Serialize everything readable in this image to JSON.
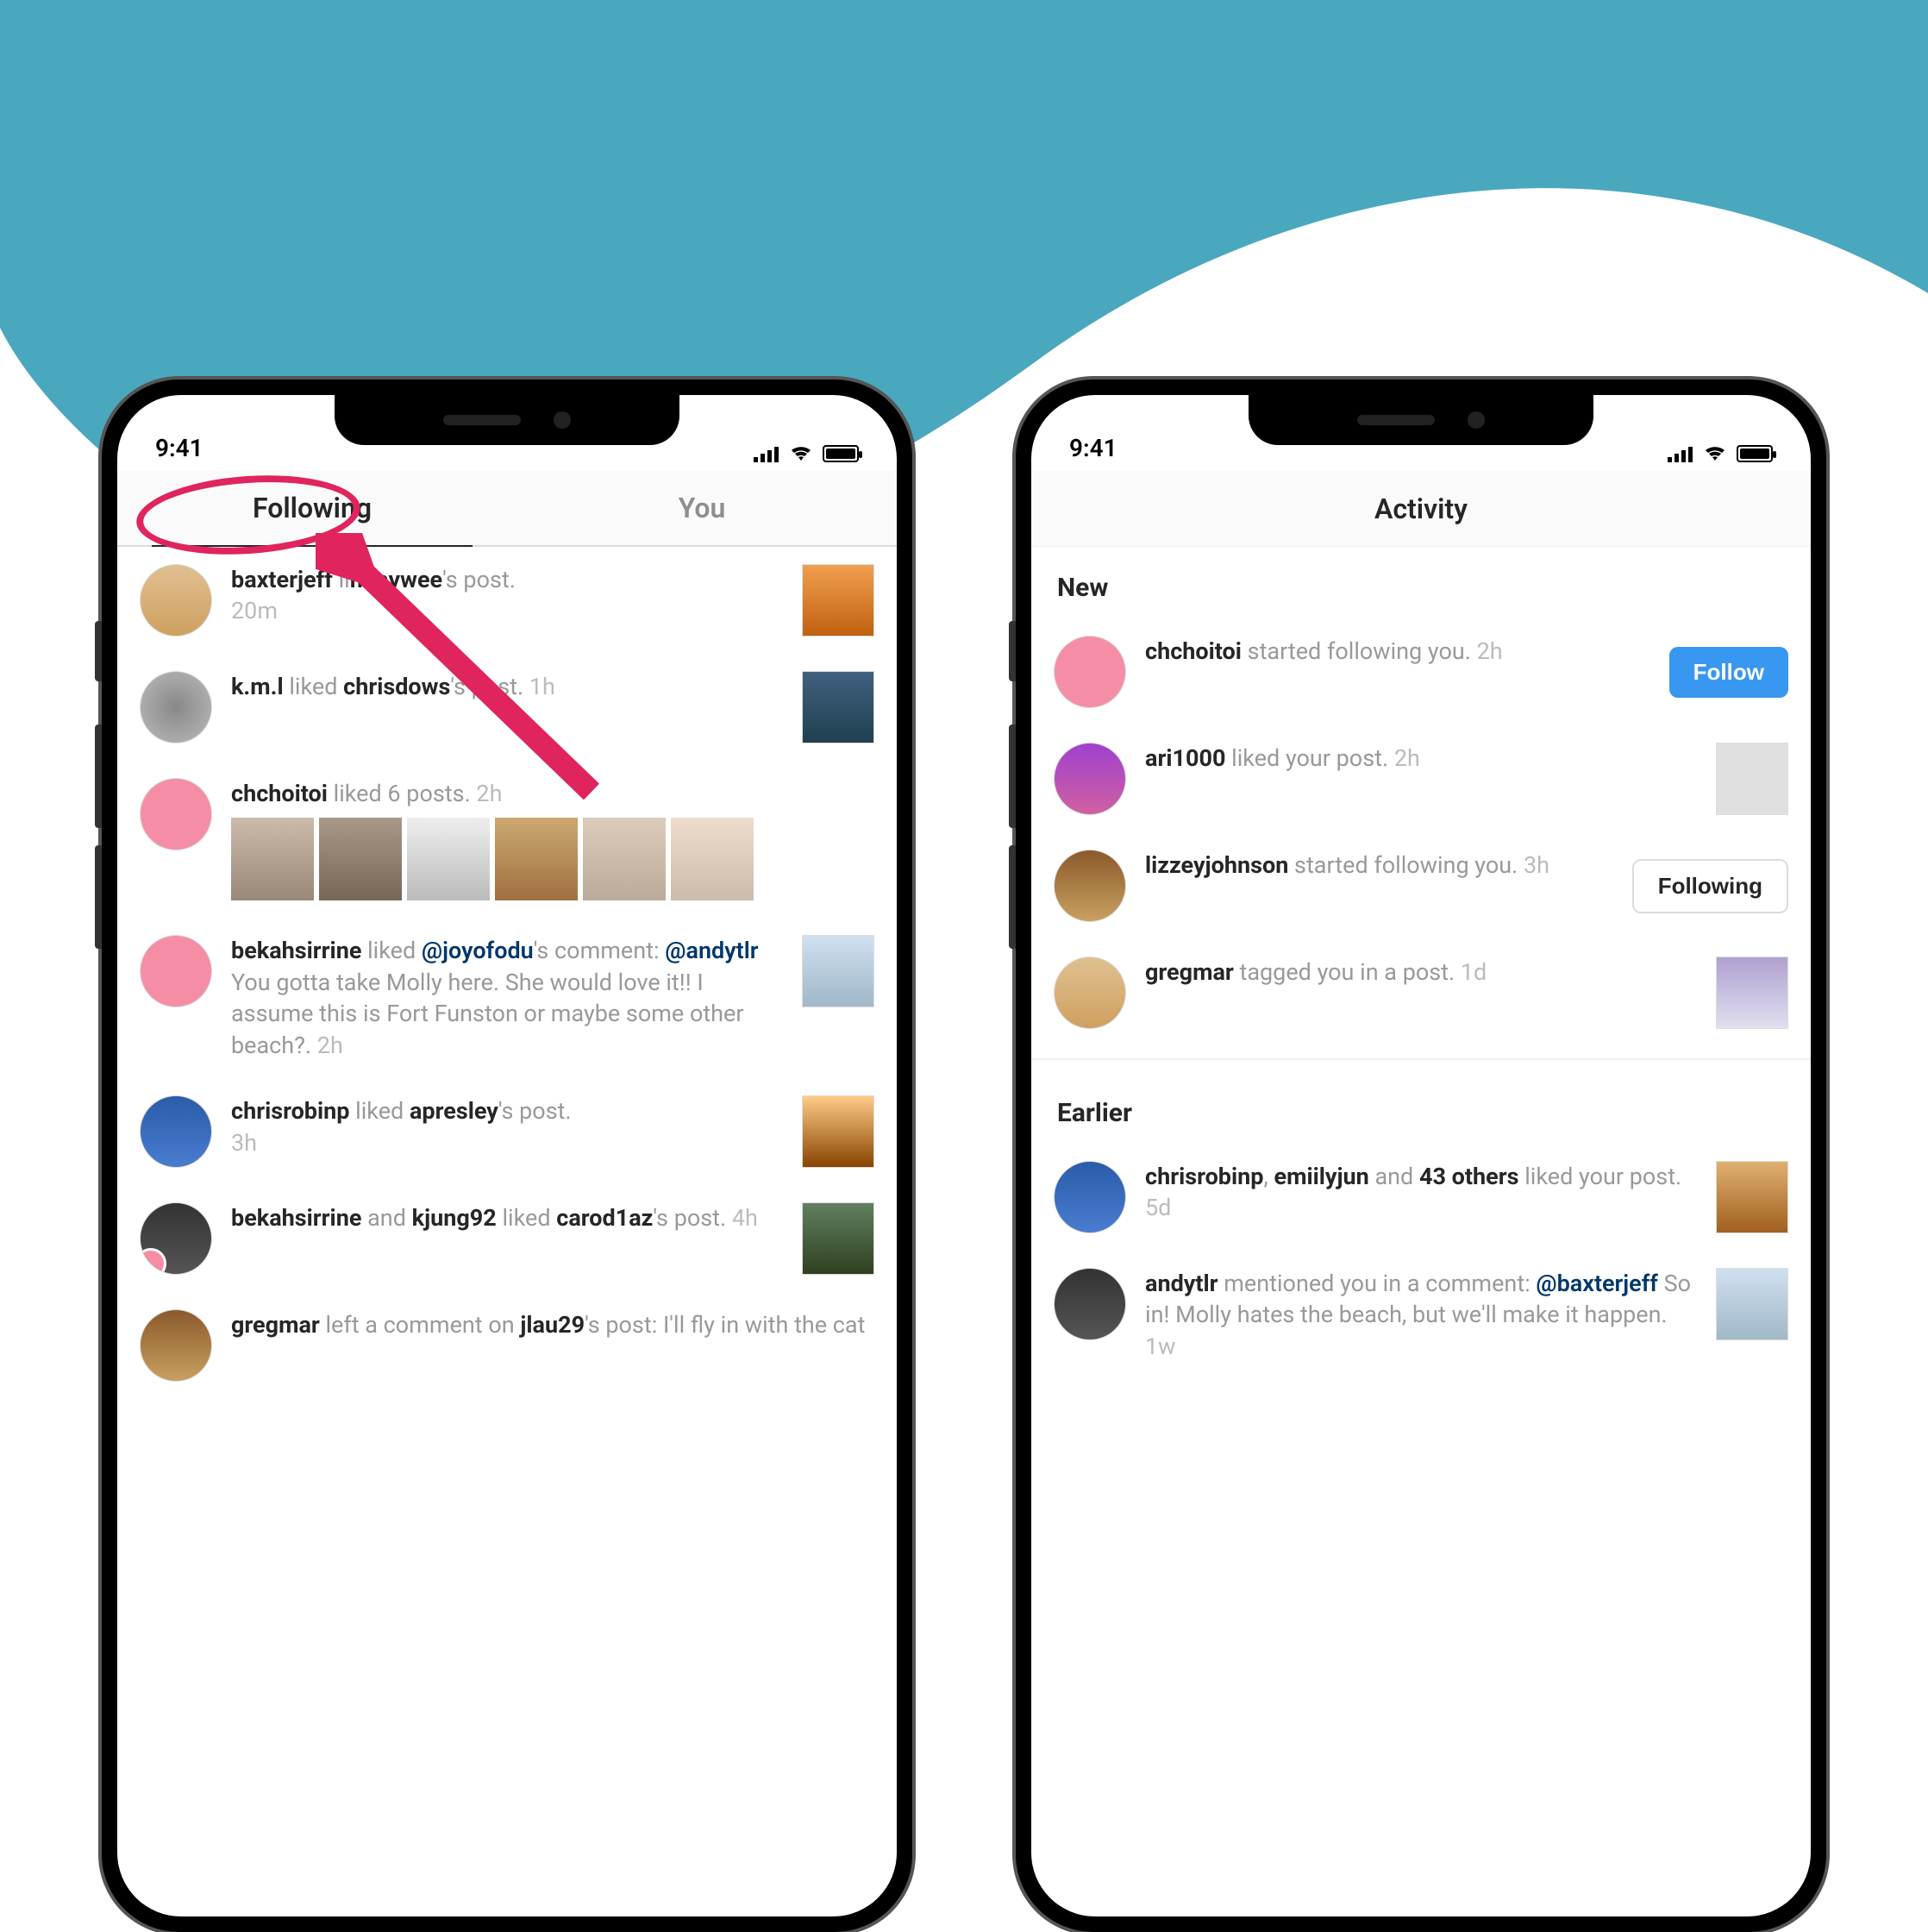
{
  "status": {
    "time": "9:41"
  },
  "left": {
    "tabs": {
      "following": "Following",
      "you": "You"
    },
    "items": [
      {
        "user": "baxterjeff",
        "action_prefix": " li",
        "obj": "miaywee",
        "action_suffix": "'s post.",
        "time": "20m"
      },
      {
        "user": "k.m.l",
        "action_prefix": " liked ",
        "obj": "chrisdows",
        "action_suffix": "'s post.",
        "time": "1h"
      },
      {
        "user": "chchoitoi",
        "action_prefix": " liked 6 posts.",
        "time": "2h"
      },
      {
        "user": "bekahsirrine",
        "action_prefix": " liked ",
        "mention1": "@joyofodu",
        "mid1": "'s comment: ",
        "mention2": "@andytlr",
        "mid2": " You gotta take Molly here. She would love it!! I assume this is Fort Funston or maybe some other beach?.",
        "time": "2h"
      },
      {
        "user": "chrisrobinp",
        "action_prefix": " liked ",
        "obj": "apresley",
        "action_suffix": "'s post.",
        "time": "3h"
      },
      {
        "user": "bekahsirrine",
        "mid1": " and ",
        "obj": "kjung92",
        "mid2": " liked ",
        "obj2": "carod1az",
        "action_suffix": "'s post.",
        "time": "4h"
      },
      {
        "user": "gregmar",
        "action_prefix": " left a comment on ",
        "obj": "jlau29",
        "action_suffix": "'s post:  I'll fly in with the cat"
      }
    ]
  },
  "right": {
    "header": "Activity",
    "sections": {
      "new": "New",
      "earlier": "Earlier"
    },
    "new_items": [
      {
        "user": "chchoitoi",
        "text": " started following you.",
        "time": "2h",
        "btn": "Follow"
      },
      {
        "user": "ari1000",
        "text": " liked your post.",
        "time": "2h"
      },
      {
        "user": "lizzeyjohnson",
        "text": " started following you.",
        "time": "3h",
        "btn": "Following"
      },
      {
        "user": "gregmar",
        "text": " tagged you in a post.",
        "time": "1d"
      }
    ],
    "earlier_items": [
      {
        "user": "chrisrobinp",
        "mid": ", ",
        "user2": "emiilyjun",
        "mid2": " and ",
        "obj": "43 others",
        "text": " liked your post.",
        "time": "5d"
      },
      {
        "user": "andytlr",
        "text": " mentioned you in a comment: ",
        "mention": "@baxterjeff",
        "text2": " So in! Molly hates the beach, but we'll make it happen.",
        "time": "1w"
      }
    ]
  }
}
